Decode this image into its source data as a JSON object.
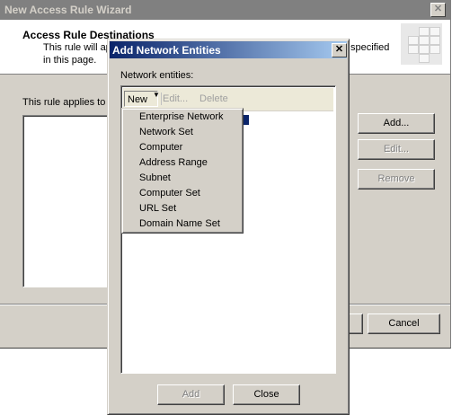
{
  "wizard": {
    "title": "New Access Rule Wizard",
    "close_glyph": "✕",
    "header_heading": "Access Rule Destinations",
    "header_desc_line1_left": "This rule will ap",
    "header_desc_line1_right": "specified",
    "header_desc_line2": "in this page.",
    "applies_label": "This rule applies to t",
    "add_button": "Add...",
    "edit_button": "Edit...",
    "remove_button": "Remove",
    "cancel_button": "Cancel"
  },
  "dialog": {
    "title": "Add Network Entities",
    "close_glyph": "✕",
    "entities_label": "Network entities:",
    "toolbar": {
      "new": "New",
      "new_arrow": "▼",
      "edit": "Edit...",
      "delete": "Delete"
    },
    "add_button": "Add",
    "close_button": "Close"
  },
  "new_menu": {
    "items": [
      "Enterprise Network",
      "Network Set",
      "Computer",
      "Address Range",
      "Subnet",
      "Computer Set",
      "URL Set",
      "Domain Name Set"
    ]
  },
  "colors": {
    "dialog_face": "#d4d0c8",
    "active_title_start": "#0a246a",
    "active_title_end": "#a6caf0",
    "inactive_title": "#808080"
  }
}
